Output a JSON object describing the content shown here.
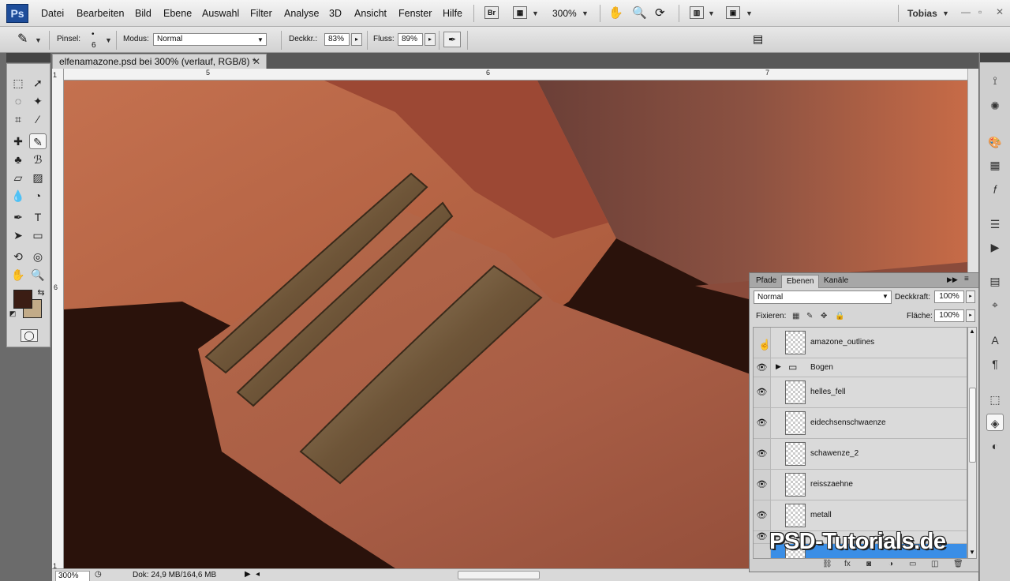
{
  "app": {
    "logo": "Ps",
    "user": "Tobias"
  },
  "menu": [
    "Datei",
    "Bearbeiten",
    "Bild",
    "Ebene",
    "Auswahl",
    "Filter",
    "Analyse",
    "3D",
    "Ansicht",
    "Fenster",
    "Hilfe"
  ],
  "menubar": {
    "bridge_label": "Br",
    "zoom": "300%"
  },
  "options": {
    "brush_label": "Pinsel:",
    "brush_size": "6",
    "mode_label": "Modus:",
    "mode_value": "Normal",
    "opacity_label": "Deckkr.:",
    "opacity_value": "83%",
    "flow_label": "Fluss:",
    "flow_value": "89%"
  },
  "document": {
    "tab_title": "elfenamazone.psd bei 300% (verlauf, RGB/8) *",
    "ruler_top": [
      "5",
      "6",
      "7"
    ],
    "ruler_left": [
      "1",
      "6",
      "1"
    ]
  },
  "status": {
    "zoom": "300%",
    "doc_info": "Dok: 24,9 MB/164,6 MB"
  },
  "colors": {
    "foreground": "#3b1d14",
    "background": "#c2ab88",
    "selection": "#3a8ee6"
  },
  "layers_panel": {
    "tabs": [
      "Pfade",
      "Ebenen",
      "Kanäle"
    ],
    "active_tab": "Ebenen",
    "blend_mode": "Normal",
    "opacity_label": "Deckkraft:",
    "opacity_value": "100%",
    "lock_label": "Fixieren:",
    "fill_label": "Fläche:",
    "fill_value": "100%",
    "layers": [
      {
        "name": "amazone_outlines",
        "visible": false,
        "type": "layer"
      },
      {
        "name": "Bogen",
        "visible": true,
        "type": "group"
      },
      {
        "name": "helles_fell",
        "visible": true,
        "type": "layer"
      },
      {
        "name": "eidechsenschwaenze",
        "visible": true,
        "type": "layer"
      },
      {
        "name": "schawenze_2",
        "visible": true,
        "type": "layer"
      },
      {
        "name": "reisszaehne",
        "visible": true,
        "type": "layer"
      },
      {
        "name": "metall",
        "visible": true,
        "type": "layer"
      },
      {
        "name": "",
        "visible": true,
        "type": "layer",
        "selected": true
      }
    ]
  },
  "watermark": "PSD-Tutorials.de"
}
